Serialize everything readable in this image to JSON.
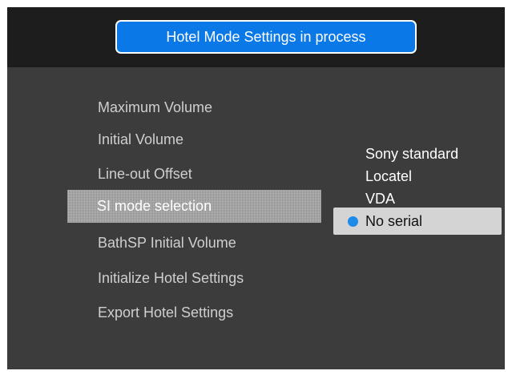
{
  "header": {
    "title": "Hotel Mode Settings in process"
  },
  "menu": {
    "items": [
      {
        "label": "Maximum Volume"
      },
      {
        "label": "Initial Volume"
      },
      {
        "label": "Line-out Offset"
      },
      {
        "label": "SI mode selection"
      },
      {
        "label": "BathSP Initial Volume"
      },
      {
        "label": "Initialize Hotel Settings"
      },
      {
        "label": "Export Hotel Settings"
      }
    ],
    "selected_label": "SI mode selection"
  },
  "options": {
    "items": [
      {
        "label": "Sony standard"
      },
      {
        "label": "Locatel"
      },
      {
        "label": "VDA"
      },
      {
        "label": "No serial"
      }
    ],
    "selected_label": "No serial"
  },
  "colors": {
    "title_banner": "#0a78e6",
    "radio_selected": "#1c8ae8",
    "background": "#3c3c3c",
    "header_bar": "#1d1d1d"
  }
}
